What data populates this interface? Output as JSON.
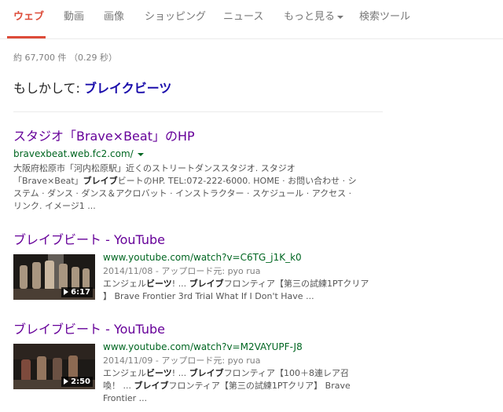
{
  "tabs": [
    {
      "label": "ウェブ",
      "active": true
    },
    {
      "label": "動画"
    },
    {
      "label": "画像"
    },
    {
      "label": "ショッピング"
    },
    {
      "label": "ニュース"
    },
    {
      "label": "もっと見る"
    },
    {
      "label": "検索ツール"
    }
  ],
  "stats": "約 67,700 件 （0.29 秒）",
  "did_you_mean": {
    "prefix": "もしかして:",
    "suggestion": "ブレイクビーツ"
  },
  "results": [
    {
      "title": "スタジオ「Brave×Beat」のHP",
      "url": "bravexbeat.web.fc2.com/",
      "snippet": {
        "l1": "大阪府松原市「河内松原駅」近くのストリートダンススタジオ. スタジオ",
        "l2_a": "「Brave×Beat」",
        "l2_b": "ブレイブ",
        "l2_c": "ビートのHP. TEL:072-222-6000. HOME · お問い合わせ · シ",
        "l3": "ステム · ダンス · ダンス＆アクロバット · インストラクター · スケジュール · アクセス ·",
        "l4": "リンク. イメージ1 ..."
      }
    },
    {
      "title": "ブレイブビート - YouTube",
      "url": "www.youtube.com/watch?v=C6TG_j1K_k0",
      "duration": "6:17",
      "meta": "2014/11/08 - アップロード元: pyo rua",
      "snippet": {
        "a": "エンジェル",
        "b": "ビーツ",
        "c": "! ... ",
        "d": "ブレイブ",
        "e": "フロンティア【第三の試練1PTクリア",
        "l2": "】 Brave Frontier 3rd Trial What If I Don't Have ..."
      }
    },
    {
      "title": "ブレイブビート - YouTube",
      "url": "www.youtube.com/watch?v=M2VAYUPF-J8",
      "duration": "2:50",
      "meta": "2014/11/09 - アップロード元: pyo rua",
      "snippet": {
        "a": "エンジェル",
        "b": "ビーツ",
        "c": "! ... ",
        "d": "ブレイブ",
        "e": "フロンティア【100＋8連レア召",
        "l2_a": "喚！ ... ",
        "l2_b": "ブレイブ",
        "l2_c": "フロンティア【第三の試練1PTクリア】 Brave",
        "l3": "Frontier ..."
      }
    }
  ],
  "icons": {
    "dropdown": "triangle-down-icon",
    "play": "play-icon"
  },
  "colors": {
    "active_tab": "#dd4b39",
    "link_visited": "#660099",
    "link": "#1a0dab",
    "url": "#006621",
    "snippet": "#545454"
  }
}
